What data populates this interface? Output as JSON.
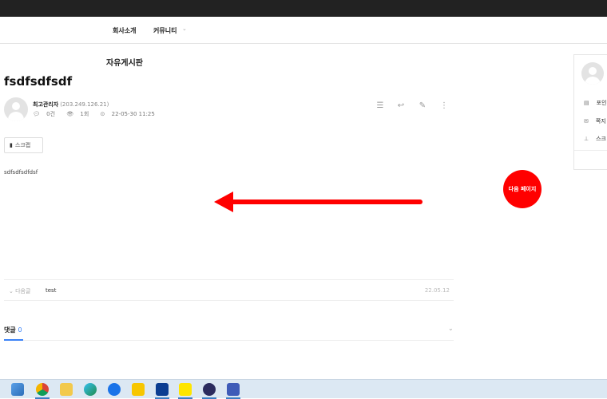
{
  "nav": {
    "items": [
      "회사소개",
      "커뮤니티"
    ],
    "chevron_icon": "chevron-down-icon"
  },
  "board": {
    "title": "자유게시판"
  },
  "post": {
    "title": "fsdfsdfsdf",
    "author_name": "최고관리자",
    "author_ip": "(203.249.126.21)",
    "comments_count": "0건",
    "views": "1회",
    "datetime": "22-05-30 11:25",
    "content": "sdfsdfsdfdsf"
  },
  "toolbar_icons": [
    "list-icon",
    "reply-icon",
    "edit-icon",
    "more-icon"
  ],
  "scrap_button": {
    "label": "스크랩",
    "icon": "bookmark-icon"
  },
  "annotation": {
    "next_page_label": "다음 페이지",
    "arrow_color": "#ff0000"
  },
  "next_post": {
    "label": "다음글",
    "title": "test",
    "date": "22.05.12"
  },
  "comments_section": {
    "label": "댓글",
    "count": "0",
    "accent": "#3b82f6"
  },
  "side_panel": {
    "items": [
      {
        "icon": "coin-icon",
        "label": "포인"
      },
      {
        "icon": "mail-icon",
        "label": "쪽지"
      },
      {
        "icon": "pin-icon",
        "label": "스크"
      }
    ]
  },
  "taskbar": {
    "icons": [
      "file-explorer-icon",
      "chrome-icon",
      "folder-icon",
      "edge-icon",
      "app-icon",
      "sticky-notes-icon",
      "terminal-icon",
      "kakaotalk-icon",
      "app-icon-2",
      "app-icon-3"
    ]
  }
}
